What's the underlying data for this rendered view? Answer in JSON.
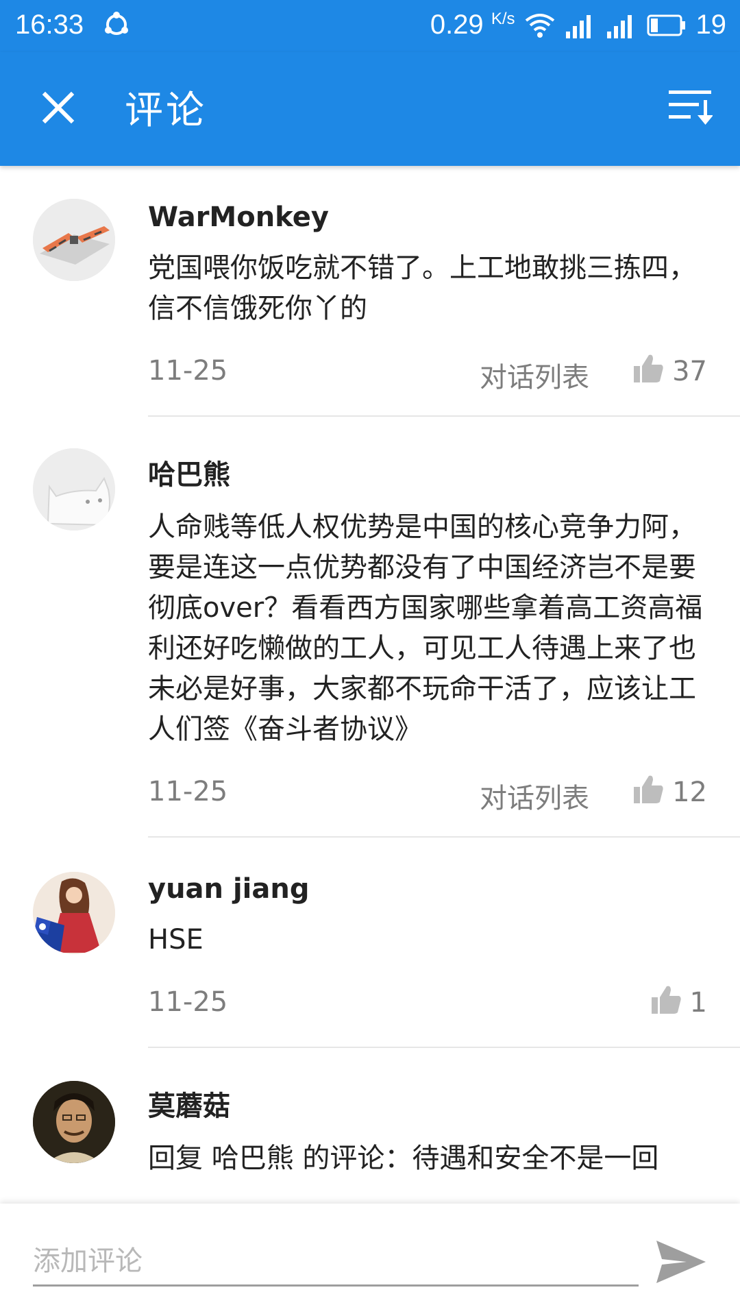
{
  "status_bar": {
    "time": "16:33",
    "network_speed": "0.29",
    "network_speed_unit": "K/s",
    "battery_level": "19"
  },
  "app_bar": {
    "title": "评论"
  },
  "comments": [
    {
      "author": "WarMonkey",
      "text": "党国喂你饭吃就不错了。上工地敢挑三拣四，信不信饿死你丫的",
      "date": "11-25",
      "thread_label": "对话列表",
      "likes": "37"
    },
    {
      "author": "哈巴熊",
      "text": "人命贱等低人权优势是中国的核心竞争力阿，要是连这一点优势都没有了中国经济岂不是要彻底over？看看西方国家哪些拿着高工资高福利还好吃懒做的工人，可见工人待遇上来了也未必是好事，大家都不玩命干活了，应该让工人们签《奋斗者协议》",
      "date": "11-25",
      "thread_label": "对话列表",
      "likes": "12"
    },
    {
      "author": "yuan jiang",
      "text": "HSE",
      "date": "11-25",
      "likes": "1"
    },
    {
      "author": "莫蘑菇",
      "text": "回复 哈巴熊 的评论：待遇和安全不是一回"
    }
  ],
  "comment_input": {
    "placeholder": "添加评论"
  },
  "colors": {
    "primary": "#1e88e5",
    "meta_text": "#7d7d7d"
  }
}
